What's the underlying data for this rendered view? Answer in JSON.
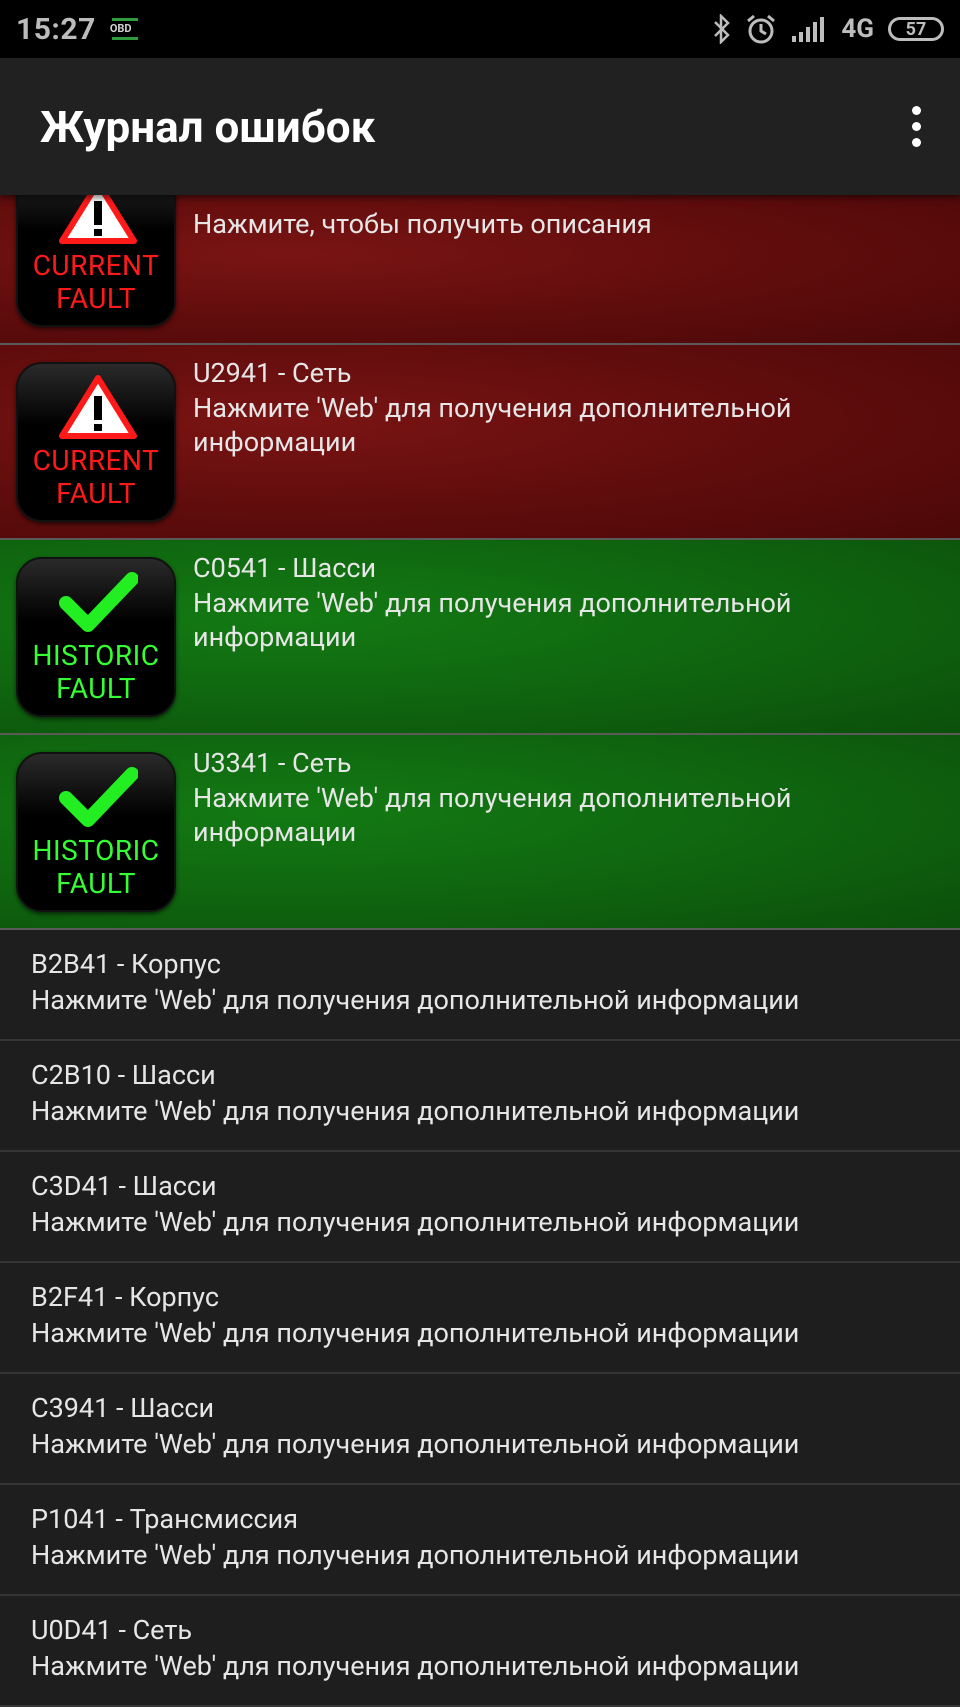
{
  "status_bar": {
    "time": "15:27",
    "obd_label": "OBD",
    "network": "4G",
    "battery": "57",
    "icons": [
      "bluetooth-icon",
      "alarm-icon",
      "signal-icon"
    ]
  },
  "app_bar": {
    "title": "Журнал ошибок",
    "overflow_icon": "more-vert-icon"
  },
  "faults": [
    {
      "type": "current",
      "badge_top": "CURRENT",
      "badge_bottom": "FAULT",
      "code": "",
      "desc": "Нажмите, чтобы получить описания"
    },
    {
      "type": "current",
      "badge_top": "CURRENT",
      "badge_bottom": "FAULT",
      "code": "U2941 - Сеть",
      "desc": "Нажмите 'Web' для получения дополнительной информации"
    },
    {
      "type": "historic",
      "badge_top": "HISTORIC",
      "badge_bottom": "FAULT",
      "code": "C0541 - Шасси",
      "desc": "Нажмите 'Web' для получения дополнительной информации"
    },
    {
      "type": "historic",
      "badge_top": "HISTORIC",
      "badge_bottom": "FAULT",
      "code": "U3341 - Сеть",
      "desc": "Нажмите 'Web' для получения дополнительной информации"
    }
  ],
  "plain_faults": [
    {
      "code": "B2B41 - Корпус",
      "desc": "Нажмите 'Web' для получения дополнительной информации"
    },
    {
      "code": "C2B10 - Шасси",
      "desc": "Нажмите 'Web' для получения дополнительной информации"
    },
    {
      "code": "C3D41 - Шасси",
      "desc": "Нажмите 'Web' для получения дополнительной информации"
    },
    {
      "code": "B2F41 - Корпус",
      "desc": "Нажмите 'Web' для получения дополнительной информации"
    },
    {
      "code": "C3941 - Шасси",
      "desc": "Нажмите 'Web' для получения дополнительной информации"
    },
    {
      "code": "P1041 - Трансмиссия",
      "desc": "Нажмите 'Web' для получения дополнительной информации"
    },
    {
      "code": "U0D41 - Сеть",
      "desc": "Нажмите 'Web' для получения дополнительной информации"
    }
  ],
  "colors": {
    "current_bg": "#6a1010",
    "historic_bg": "#0f650f",
    "current_text": "#ff1a1a",
    "historic_text": "#33ff33"
  }
}
